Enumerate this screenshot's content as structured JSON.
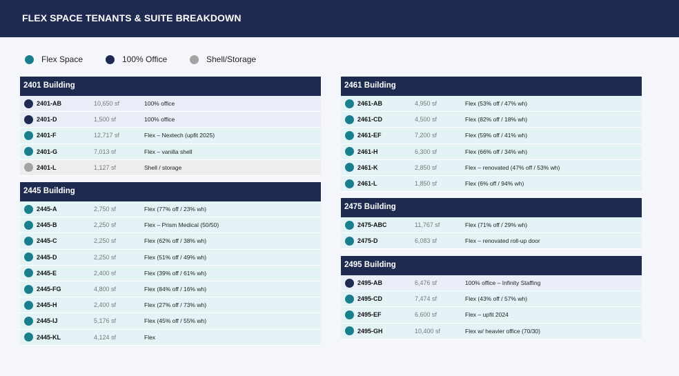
{
  "title": "FLEX SPACE TENANTS & SUITE BREAKDOWN",
  "colors": {
    "flex": "#1a7f8c",
    "office": "#1e2a4f",
    "shell": "#a3a3a3",
    "header": "#1e2a4f"
  },
  "legend": [
    {
      "label": "Flex Space",
      "type": "flex"
    },
    {
      "label": "100% Office",
      "type": "office"
    },
    {
      "label": "Shell/Storage",
      "type": "shell"
    }
  ],
  "sections": [
    {
      "id": "2401",
      "title": "2401 Building",
      "rows": [
        {
          "suite": "2401-AB",
          "size": "10,650 sf",
          "desc": "100% office",
          "type": "office"
        },
        {
          "suite": "2401-D",
          "size": "1,500 sf",
          "desc": "100% office",
          "type": "office"
        },
        {
          "suite": "2401-F",
          "size": "12,717 sf",
          "desc": "Flex – Nextech (upfit 2025)",
          "type": "flex"
        },
        {
          "suite": "2401-G",
          "size": "7,013 sf",
          "desc": "Flex – vanilla shell",
          "type": "flex"
        },
        {
          "suite": "2401-L",
          "size": "1,127 sf",
          "desc": "Shell / storage",
          "type": "shell"
        }
      ]
    },
    {
      "id": "2445",
      "title": "2445 Building",
      "rows": [
        {
          "suite": "2445-A",
          "size": "2,750 sf",
          "desc": "Flex (77% off / 23% wh)",
          "type": "flex"
        },
        {
          "suite": "2445-B",
          "size": "2,250 sf",
          "desc": "Flex – Prism Medical (50/50)",
          "type": "flex"
        },
        {
          "suite": "2445-C",
          "size": "2,250 sf",
          "desc": "Flex (62% off / 38% wh)",
          "type": "flex"
        },
        {
          "suite": "2445-D",
          "size": "2,250 sf",
          "desc": "Flex (51% off / 49% wh)",
          "type": "flex"
        },
        {
          "suite": "2445-E",
          "size": "2,400 sf",
          "desc": "Flex (39% off / 61% wh)",
          "type": "flex"
        },
        {
          "suite": "2445-FG",
          "size": "4,800 sf",
          "desc": "Flex (84% off / 16% wh)",
          "type": "flex"
        },
        {
          "suite": "2445-H",
          "size": "2,400 sf",
          "desc": "Flex (27% off / 73% wh)",
          "type": "flex"
        },
        {
          "suite": "2445-IJ",
          "size": "5,176 sf",
          "desc": "Flex (45% off / 55% wh)",
          "type": "flex"
        },
        {
          "suite": "2445-KL",
          "size": "4,124 sf",
          "desc": "Flex",
          "type": "flex"
        }
      ]
    },
    {
      "id": "2461",
      "title": "2461 Building",
      "rows": [
        {
          "suite": "2461-AB",
          "size": "4,950 sf",
          "desc": "Flex (53% off / 47% wh)",
          "type": "flex"
        },
        {
          "suite": "2461-CD",
          "size": "4,500 sf",
          "desc": "Flex (82% off / 18% wh)",
          "type": "flex"
        },
        {
          "suite": "2461-EF",
          "size": "7,200 sf",
          "desc": "Flex (59% off / 41% wh)",
          "type": "flex"
        },
        {
          "suite": "2461-H",
          "size": "6,300 sf",
          "desc": "Flex (66% off / 34% wh)",
          "type": "flex"
        },
        {
          "suite": "2461-K",
          "size": "2,850 sf",
          "desc": "Flex – renovated (47% off / 53% wh)",
          "type": "flex"
        },
        {
          "suite": "2461-L",
          "size": "1,850 sf",
          "desc": "Flex (6% off / 94% wh)",
          "type": "flex"
        }
      ]
    },
    {
      "id": "2475",
      "title": "2475 Building",
      "rows": [
        {
          "suite": "2475-ABC",
          "size": "11,767 sf",
          "desc": "Flex (71% off / 29% wh)",
          "type": "flex"
        },
        {
          "suite": "2475-D",
          "size": "6,083 sf",
          "desc": "Flex – renovated roll-up door",
          "type": "flex"
        }
      ]
    },
    {
      "id": "2495",
      "title": "2495 Building",
      "rows": [
        {
          "suite": "2495-AB",
          "size": "6,476 sf",
          "desc": "100% office – Infinity Staffing",
          "type": "office"
        },
        {
          "suite": "2495-CD",
          "size": "7,474 sf",
          "desc": "Flex (43% off / 57% wh)",
          "type": "flex"
        },
        {
          "suite": "2495-EF",
          "size": "6,600 sf",
          "desc": "Flex – upfit 2024",
          "type": "flex"
        },
        {
          "suite": "2495-GH",
          "size": "10,400 sf",
          "desc": "Flex w/ heavier office (70/30)",
          "type": "flex"
        }
      ]
    }
  ]
}
